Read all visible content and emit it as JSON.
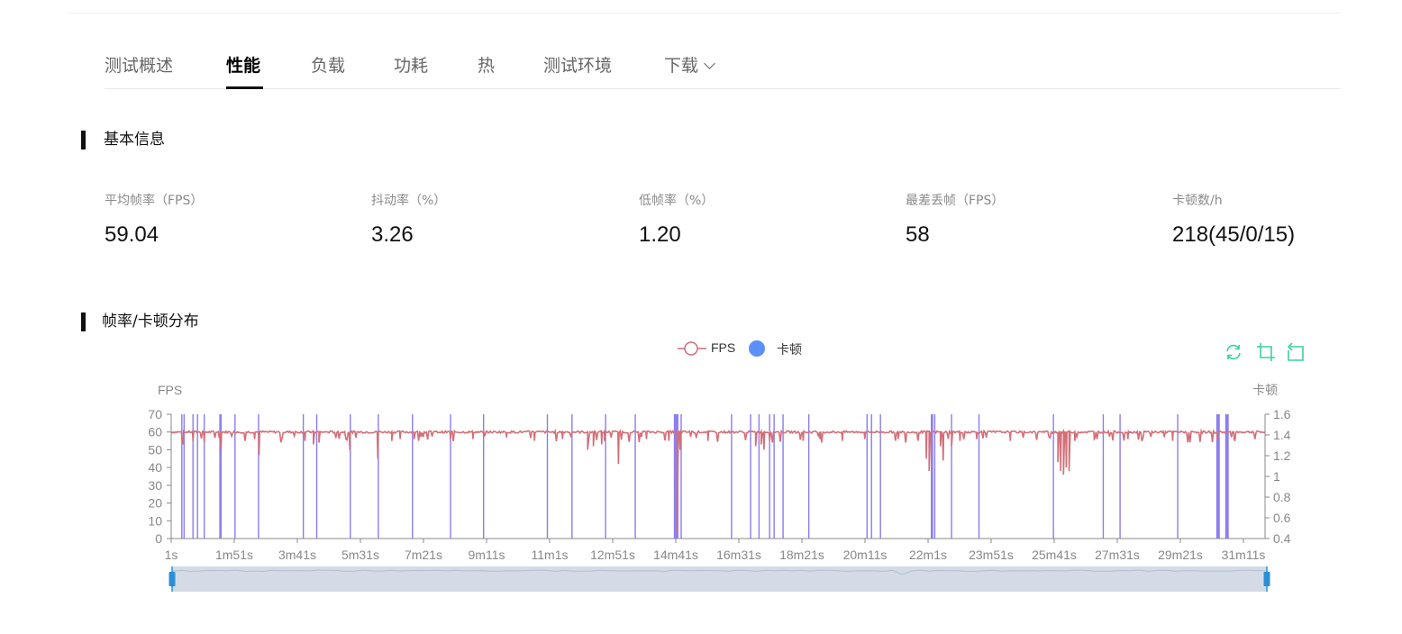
{
  "tabs": [
    {
      "label": "测试概述",
      "active": false
    },
    {
      "label": "性能",
      "active": true
    },
    {
      "label": "负载",
      "active": false
    },
    {
      "label": "功耗",
      "active": false
    },
    {
      "label": "热",
      "active": false
    },
    {
      "label": "测试环境",
      "active": false
    },
    {
      "label": "下载",
      "active": false,
      "dropdown": true
    }
  ],
  "basic_info": {
    "title": "基本信息",
    "metrics": [
      {
        "label": "平均帧率（FPS）",
        "value": "59.04"
      },
      {
        "label": "抖动率（%）",
        "value": "3.26"
      },
      {
        "label": "低帧率（%）",
        "value": "1.20"
      },
      {
        "label": "最差丢帧（FPS）",
        "value": "58"
      },
      {
        "label": "卡顿数/h",
        "value": "218(45/0/15)"
      }
    ]
  },
  "chart_section": {
    "title": "帧率/卡顿分布",
    "toolbar": {
      "icons": [
        "refresh-icon",
        "crop-icon",
        "restore-icon"
      ],
      "color": "#3ccf9e"
    }
  },
  "chart_data": {
    "type": "line",
    "legend": [
      {
        "name": "FPS",
        "color": "#d36f78",
        "marker": "line-circle"
      },
      {
        "name": "卡顿",
        "color": "#5b8ff9",
        "marker": "circle"
      }
    ],
    "ylabel_left": "FPS",
    "ylabel_right": "卡顿",
    "ylim_left": [
      0,
      70
    ],
    "yticks_left": [
      0,
      10,
      20,
      30,
      40,
      50,
      60,
      70
    ],
    "ylim_right": [
      0.4,
      1.6
    ],
    "yticks_right": [
      "0.4",
      "0.6",
      "0.8",
      "1",
      "1.2",
      "1.4",
      "1.6"
    ],
    "xlim_seconds": [
      1,
      1955
    ],
    "xticks": [
      "1s",
      "1m51s",
      "3m41s",
      "5m31s",
      "7m21s",
      "9m11s",
      "11m1s",
      "12m51s",
      "14m41s",
      "16m31s",
      "18m21s",
      "20m11s",
      "22m1s",
      "23m51s",
      "25m41s",
      "27m31s",
      "29m21s",
      "31m11s"
    ],
    "fps_baseline": 60,
    "fps_dips": [
      {
        "t": 22,
        "v": 53
      },
      {
        "t": 40,
        "v": 55
      },
      {
        "t": 60,
        "v": 54
      },
      {
        "t": 90,
        "v": 50
      },
      {
        "t": 150,
        "v": 56
      },
      {
        "t": 158,
        "v": 47
      },
      {
        "t": 240,
        "v": 55
      },
      {
        "t": 255,
        "v": 53
      },
      {
        "t": 265,
        "v": 54
      },
      {
        "t": 320,
        "v": 50
      },
      {
        "t": 370,
        "v": 45
      },
      {
        "t": 395,
        "v": 55
      },
      {
        "t": 410,
        "v": 56
      },
      {
        "t": 435,
        "v": 56
      },
      {
        "t": 500,
        "v": 56
      },
      {
        "t": 540,
        "v": 56
      },
      {
        "t": 600,
        "v": 57
      },
      {
        "t": 650,
        "v": 55
      },
      {
        "t": 700,
        "v": 56
      },
      {
        "t": 745,
        "v": 50
      },
      {
        "t": 755,
        "v": 52
      },
      {
        "t": 770,
        "v": 53
      },
      {
        "t": 775,
        "v": 55
      },
      {
        "t": 800,
        "v": 42
      },
      {
        "t": 850,
        "v": 56
      },
      {
        "t": 890,
        "v": 55
      },
      {
        "t": 905,
        "v": 3
      },
      {
        "t": 910,
        "v": 50
      },
      {
        "t": 960,
        "v": 55
      },
      {
        "t": 1045,
        "v": 52
      },
      {
        "t": 1055,
        "v": 53
      },
      {
        "t": 1060,
        "v": 50
      },
      {
        "t": 1070,
        "v": 55
      },
      {
        "t": 1130,
        "v": 55
      },
      {
        "t": 1160,
        "v": 56
      },
      {
        "t": 1200,
        "v": 55
      },
      {
        "t": 1240,
        "v": 56
      },
      {
        "t": 1300,
        "v": 56
      },
      {
        "t": 1350,
        "v": 45
      },
      {
        "t": 1355,
        "v": 38
      },
      {
        "t": 1375,
        "v": 52
      },
      {
        "t": 1380,
        "v": 44
      },
      {
        "t": 1395,
        "v": 52
      },
      {
        "t": 1410,
        "v": 55
      },
      {
        "t": 1440,
        "v": 56
      },
      {
        "t": 1500,
        "v": 55
      },
      {
        "t": 1585,
        "v": 43
      },
      {
        "t": 1590,
        "v": 38
      },
      {
        "t": 1595,
        "v": 36
      },
      {
        "t": 1600,
        "v": 40
      },
      {
        "t": 1605,
        "v": 38
      },
      {
        "t": 1615,
        "v": 55
      },
      {
        "t": 1650,
        "v": 56
      },
      {
        "t": 1710,
        "v": 56
      },
      {
        "t": 1790,
        "v": 55
      },
      {
        "t": 1870,
        "v": 55
      },
      {
        "t": 1900,
        "v": 56
      }
    ],
    "stutter_times_seconds": [
      20,
      24,
      40,
      48,
      60,
      88,
      90,
      115,
      157,
      237,
      261,
      321,
      371,
      432,
      500,
      559,
      673,
      717,
      777,
      830,
      900,
      902,
      904,
      906,
      912,
      1002,
      1036,
      1051,
      1070,
      1078,
      1094,
      1140,
      1244,
      1252,
      1268,
      1359,
      1361,
      1365,
      1395,
      1444,
      1577,
      1666,
      1696,
      1799,
      1869,
      1871,
      1873,
      1885,
      1887,
      1889
    ],
    "zoom_range": [
      0,
      100
    ]
  }
}
